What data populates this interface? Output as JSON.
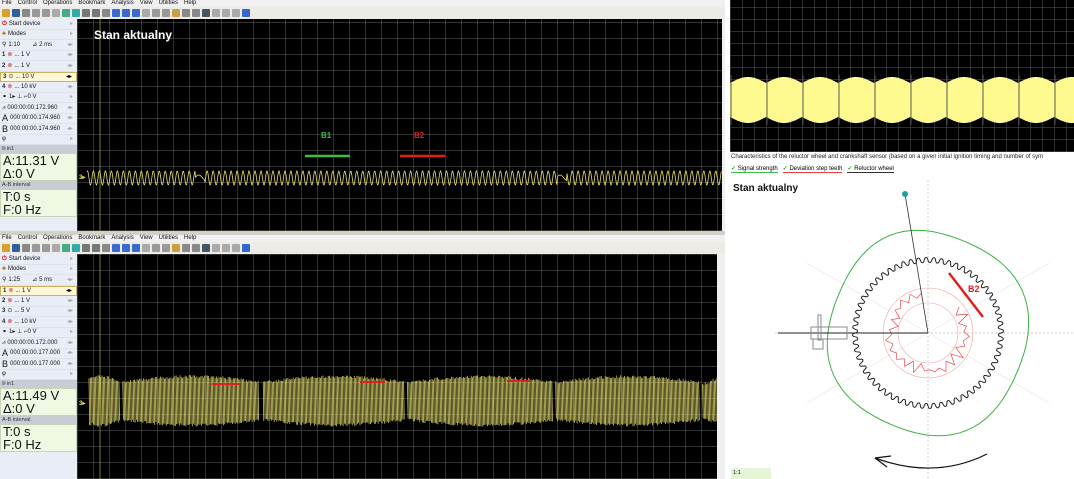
{
  "menu": [
    "File",
    "Control",
    "Operations",
    "Bookmark",
    "Analysis",
    "View",
    "Utilities",
    "Help"
  ],
  "top": {
    "title": "Stan aktualny",
    "start": "Start device",
    "modes": "Modes",
    "zoom": "1:10",
    "timebase": "2 ms",
    "channels": [
      {
        "n": "1",
        "v": "... 1 V"
      },
      {
        "n": "2",
        "v": "... 1 V"
      },
      {
        "n": "3",
        "v": "... 10 V"
      },
      {
        "n": "4",
        "v": "... 10 kV"
      }
    ],
    "trigger": "1▸  ⊥ ⌐0 V",
    "time": "000:00:00.172.960",
    "a": "000:00:00.174.960",
    "b": "000:00:00.174.960",
    "phi": "φ",
    "in_label": "⊪in1",
    "a_val": "A:11.31 V",
    "delta": "Δ:0 V",
    "ab_label": "A-B interval",
    "t_val": "T:0 s",
    "f_val": "F:0 Hz",
    "marker_b1": "B1",
    "marker_b2": "B2",
    "ch_marker": "3▸"
  },
  "bottom": {
    "start": "Start device",
    "modes": "Modes",
    "zoom": "1:25",
    "timebase": "5 ms",
    "channels": [
      {
        "n": "1",
        "v": "... 1 V"
      },
      {
        "n": "2",
        "v": "... 1 V"
      },
      {
        "n": "3",
        "v": "... 5 V"
      },
      {
        "n": "4",
        "v": "... 10 kV"
      }
    ],
    "trigger": "1▸  ⊥ ⌐0 V",
    "time": "000:00:00.172.000",
    "a": "000:00:00.177.000",
    "b": "000:00:00.177.000",
    "phi": "φ",
    "in_label": "⊪in1",
    "a_val": "A:11.49 V",
    "delta": "Δ:0 V",
    "ab_label": "A-B interval",
    "t_val": "T:0 s",
    "f_val": "F:0 Hz",
    "ch_marker": "3▸"
  },
  "right": {
    "description": "Characteristics of the reluctor wheel and crankshaft sensor (based on a given initial ignition timing and number of sym",
    "checks": [
      "Signal strength",
      "Deviation step teeth",
      "Reluctor wheel"
    ],
    "title": "Stan aktualny",
    "marker_b2": "B2",
    "ratio": "1:1"
  },
  "colors": {
    "signal": "#e8e070",
    "b1": "#3cbf4a",
    "b2": "#e02020",
    "wave_fill": "#fffa90"
  }
}
